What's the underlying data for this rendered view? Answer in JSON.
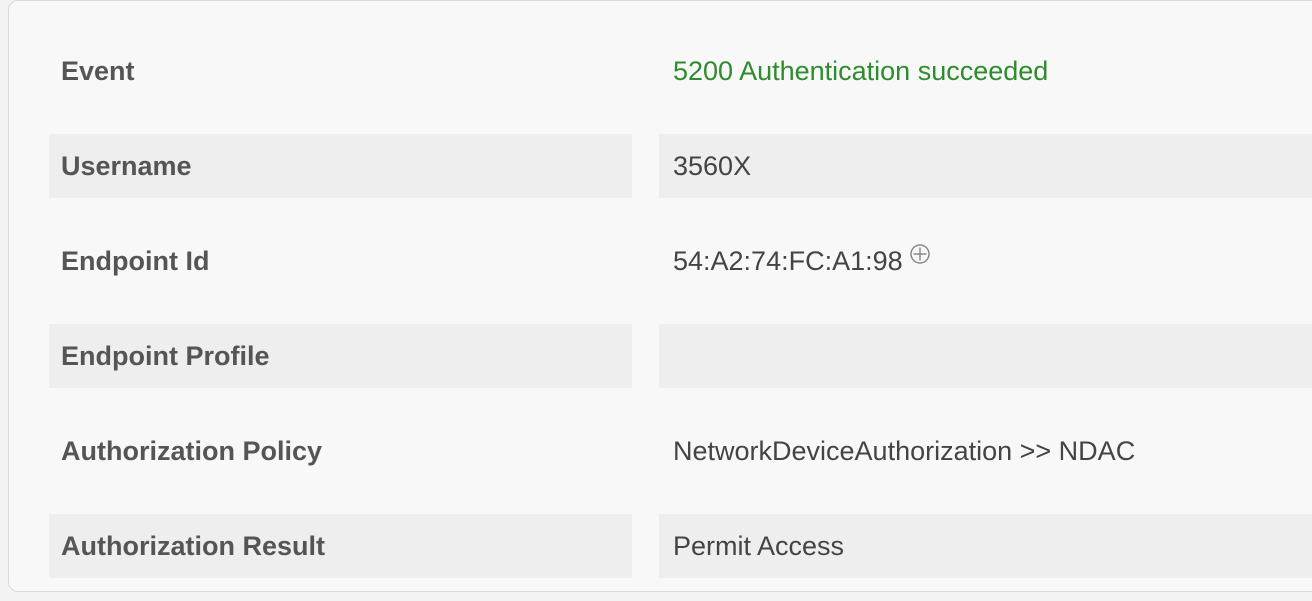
{
  "details": {
    "rows": [
      {
        "label": "Event",
        "value": "5200 Authentication succeeded"
      },
      {
        "label": "Username",
        "value": "3560X"
      },
      {
        "label": "Endpoint Id",
        "value": "54:A2:74:FC:A1:98"
      },
      {
        "label": "Endpoint Profile",
        "value": ""
      },
      {
        "label": "Authorization Policy",
        "value": "NetworkDeviceAuthorization >> NDAC"
      },
      {
        "label": "Authorization Result",
        "value": "Permit Access"
      }
    ],
    "endpoint_icon": "plus-circle-icon",
    "colors": {
      "success": "#2e8b2e",
      "label": "#555555",
      "value": "#444444",
      "shaded_row": "#eeeeee"
    }
  }
}
